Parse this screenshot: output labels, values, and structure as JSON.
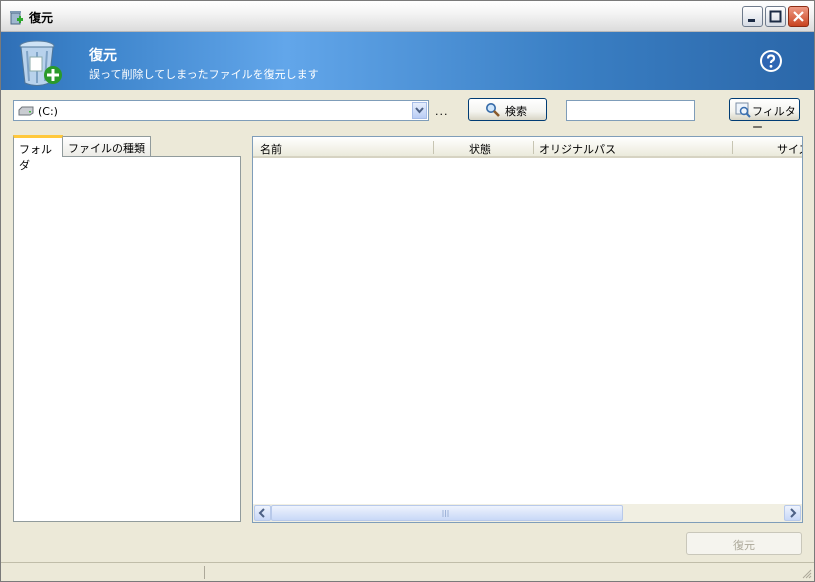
{
  "window": {
    "title": "復元",
    "icons": {
      "app": "recycle-restore-icon",
      "minimize": "minimize-icon",
      "maximize": "maximize-icon",
      "close": "close-icon"
    }
  },
  "header": {
    "title": "復元",
    "subtitle": "誤って削除してしまったファイルを復元します",
    "icon": "recycle-bin-restore-icon",
    "help_icon": "help-icon"
  },
  "toolbar": {
    "drive": {
      "label": "(C:)",
      "icon": "drive-icon"
    },
    "ellipsis": "...",
    "search_button": "検索",
    "search_value": "",
    "filter_button": "フィルター"
  },
  "left_panel": {
    "tabs": [
      {
        "label": "フォルダ",
        "active": true
      },
      {
        "label": "ファイルの種類",
        "active": false
      }
    ]
  },
  "file_list": {
    "columns": [
      "名前",
      "状態",
      "オリジナルパス",
      "サイズ"
    ],
    "rows": []
  },
  "footer": {
    "restore_button": "復元"
  },
  "colors": {
    "banner": "#3b82c9",
    "accent_tab": "#ffc83c",
    "close_button": "#c94420"
  }
}
